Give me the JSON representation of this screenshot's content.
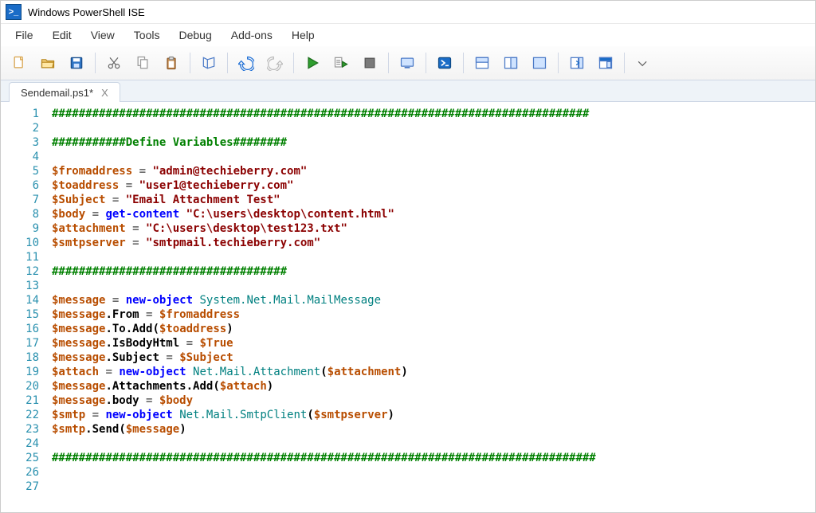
{
  "titlebar": {
    "title": "Windows PowerShell ISE",
    "icon": "powershell-icon"
  },
  "menubar": [
    {
      "label": "File"
    },
    {
      "label": "Edit"
    },
    {
      "label": "View"
    },
    {
      "label": "Tools"
    },
    {
      "label": "Debug"
    },
    {
      "label": "Add-ons"
    },
    {
      "label": "Help"
    }
  ],
  "toolbar": [
    {
      "name": "new-file-icon"
    },
    {
      "name": "open-file-icon"
    },
    {
      "name": "save-icon"
    },
    {
      "sep": true
    },
    {
      "name": "cut-icon"
    },
    {
      "name": "copy-icon"
    },
    {
      "name": "paste-icon"
    },
    {
      "sep": true
    },
    {
      "name": "clear-console-icon"
    },
    {
      "sep": true
    },
    {
      "name": "undo-icon"
    },
    {
      "name": "redo-icon"
    },
    {
      "sep": true
    },
    {
      "name": "run-icon"
    },
    {
      "name": "run-selection-icon"
    },
    {
      "name": "stop-icon"
    },
    {
      "sep": true
    },
    {
      "name": "new-remote-tab-icon"
    },
    {
      "sep": true
    },
    {
      "name": "start-powershell-icon"
    },
    {
      "sep": true
    },
    {
      "name": "show-script-top-icon"
    },
    {
      "name": "show-script-right-icon"
    },
    {
      "name": "show-script-max-icon"
    },
    {
      "sep": true
    },
    {
      "name": "show-commands-icon"
    },
    {
      "name": "show-commands-addon-icon"
    },
    {
      "sep": true
    },
    {
      "name": "toolbar-options-icon"
    }
  ],
  "tab": {
    "label": "Sendemail.ps1*",
    "close": "X"
  },
  "code": [
    [
      {
        "t": "comment",
        "v": "################################################################################"
      }
    ],
    [],
    [
      {
        "t": "comment",
        "v": "###########Define Variables########"
      }
    ],
    [],
    [
      {
        "t": "var",
        "v": "$fromaddress"
      },
      {
        "t": "op",
        "v": " = "
      },
      {
        "t": "str",
        "v": "\"admin@techieberry.com\""
      }
    ],
    [
      {
        "t": "var",
        "v": "$toaddress"
      },
      {
        "t": "op",
        "v": " = "
      },
      {
        "t": "str",
        "v": "\"user1@techieberry.com\""
      }
    ],
    [
      {
        "t": "var",
        "v": "$Subject"
      },
      {
        "t": "op",
        "v": " = "
      },
      {
        "t": "str",
        "v": "\"Email Attachment Test\""
      }
    ],
    [
      {
        "t": "var",
        "v": "$body"
      },
      {
        "t": "op",
        "v": " = "
      },
      {
        "t": "cmd",
        "v": "get-content"
      },
      {
        "t": "op",
        "v": " "
      },
      {
        "t": "str",
        "v": "\"C:\\users\\desktop\\content.html\""
      }
    ],
    [
      {
        "t": "var",
        "v": "$attachment"
      },
      {
        "t": "op",
        "v": " = "
      },
      {
        "t": "str",
        "v": "\"C:\\users\\desktop\\test123.txt\""
      }
    ],
    [
      {
        "t": "var",
        "v": "$smtpserver"
      },
      {
        "t": "op",
        "v": " = "
      },
      {
        "t": "str",
        "v": "\"smtpmail.techieberry.com\""
      }
    ],
    [],
    [
      {
        "t": "comment",
        "v": "###################################"
      }
    ],
    [],
    [
      {
        "t": "var",
        "v": "$message"
      },
      {
        "t": "op",
        "v": " = "
      },
      {
        "t": "cmd",
        "v": "new-object"
      },
      {
        "t": "op",
        "v": " "
      },
      {
        "t": "type",
        "v": "System.Net.Mail.MailMessage"
      }
    ],
    [
      {
        "t": "var",
        "v": "$message"
      },
      {
        "t": "dot",
        "v": "."
      },
      {
        "t": "member",
        "v": "From"
      },
      {
        "t": "op",
        "v": " = "
      },
      {
        "t": "var",
        "v": "$fromaddress"
      }
    ],
    [
      {
        "t": "var",
        "v": "$message"
      },
      {
        "t": "dot",
        "v": "."
      },
      {
        "t": "member",
        "v": "To"
      },
      {
        "t": "dot",
        "v": "."
      },
      {
        "t": "member",
        "v": "Add"
      },
      {
        "t": "paren",
        "v": "("
      },
      {
        "t": "var",
        "v": "$toaddress"
      },
      {
        "t": "paren",
        "v": ")"
      }
    ],
    [
      {
        "t": "var",
        "v": "$message"
      },
      {
        "t": "dot",
        "v": "."
      },
      {
        "t": "member",
        "v": "IsBodyHtml"
      },
      {
        "t": "op",
        "v": " = "
      },
      {
        "t": "var",
        "v": "$True"
      }
    ],
    [
      {
        "t": "var",
        "v": "$message"
      },
      {
        "t": "dot",
        "v": "."
      },
      {
        "t": "member",
        "v": "Subject"
      },
      {
        "t": "op",
        "v": " = "
      },
      {
        "t": "var",
        "v": "$Subject"
      }
    ],
    [
      {
        "t": "var",
        "v": "$attach"
      },
      {
        "t": "op",
        "v": " = "
      },
      {
        "t": "cmd",
        "v": "new-object"
      },
      {
        "t": "op",
        "v": " "
      },
      {
        "t": "type",
        "v": "Net.Mail.Attachment"
      },
      {
        "t": "paren",
        "v": "("
      },
      {
        "t": "var",
        "v": "$attachment"
      },
      {
        "t": "paren",
        "v": ")"
      }
    ],
    [
      {
        "t": "var",
        "v": "$message"
      },
      {
        "t": "dot",
        "v": "."
      },
      {
        "t": "member",
        "v": "Attachments"
      },
      {
        "t": "dot",
        "v": "."
      },
      {
        "t": "member",
        "v": "Add"
      },
      {
        "t": "paren",
        "v": "("
      },
      {
        "t": "var",
        "v": "$attach"
      },
      {
        "t": "paren",
        "v": ")"
      }
    ],
    [
      {
        "t": "var",
        "v": "$message"
      },
      {
        "t": "dot",
        "v": "."
      },
      {
        "t": "member",
        "v": "body"
      },
      {
        "t": "op",
        "v": " = "
      },
      {
        "t": "var",
        "v": "$body"
      }
    ],
    [
      {
        "t": "var",
        "v": "$smtp"
      },
      {
        "t": "op",
        "v": " = "
      },
      {
        "t": "cmd",
        "v": "new-object"
      },
      {
        "t": "op",
        "v": " "
      },
      {
        "t": "type",
        "v": "Net.Mail.SmtpClient"
      },
      {
        "t": "paren",
        "v": "("
      },
      {
        "t": "var",
        "v": "$smtpserver"
      },
      {
        "t": "paren",
        "v": ")"
      }
    ],
    [
      {
        "t": "var",
        "v": "$smtp"
      },
      {
        "t": "dot",
        "v": "."
      },
      {
        "t": "member",
        "v": "Send"
      },
      {
        "t": "paren",
        "v": "("
      },
      {
        "t": "var",
        "v": "$message"
      },
      {
        "t": "paren",
        "v": ")"
      }
    ],
    [],
    [
      {
        "t": "comment",
        "v": "#################################################################################"
      }
    ],
    [],
    []
  ],
  "colors": {
    "accent": "#1a6cc7"
  }
}
